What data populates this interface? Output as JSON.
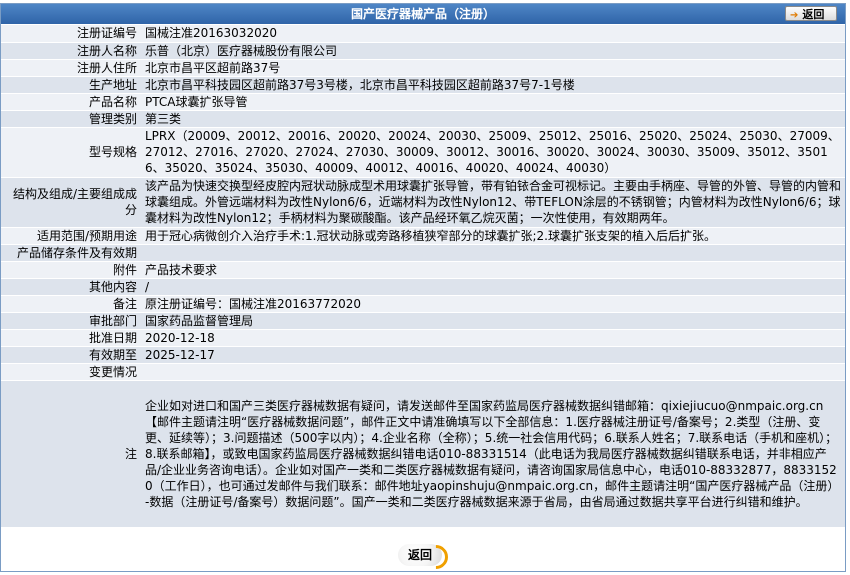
{
  "header": {
    "title": "国产医疗器械产品（注册）",
    "back_label": "返回"
  },
  "rows": [
    {
      "label": "注册证编号",
      "value": "国械注准20163032020"
    },
    {
      "label": "注册人名称",
      "value": "乐普（北京）医疗器械股份有限公司"
    },
    {
      "label": "注册人住所",
      "value": "北京市昌平区超前路37号"
    },
    {
      "label": "生产地址",
      "value": "北京市昌平科技园区超前路37号3号楼，北京市昌平科技园区超前路37号7-1号楼"
    },
    {
      "label": "产品名称",
      "value": "PTCA球囊扩张导管"
    },
    {
      "label": "管理类别",
      "value": "第三类"
    },
    {
      "label": "型号规格",
      "value": "LPRX（20009、20012、20016、20020、20024、20030、25009、25012、25016、25020、25024、25030、27009、27012、27016、27020、27024、27030、30009、30012、30016、30020、30024、30030、35009、35012、35016、35020、35024、35030、40009、40012、40016、40020、40024、40030）"
    },
    {
      "label": "结构及组成/主要组成成分",
      "value": "该产品为快速交换型经皮腔内冠状动脉成型术用球囊扩张导管，带有铂铱合金可视标记。主要由手柄座、导管的外管、导管的内管和球囊组成。外管远端材料为改性Nylon6/6，近端材料为改性Nylon12、带TEFLON涂层的不锈钢管；内管材料为改性Nylon6/6；球囊材料为改性Nylon12；手柄材料为聚碳酸酯。该产品经环氧乙烷灭菌；一次性使用，有效期两年。"
    },
    {
      "label": "适用范围/预期用途",
      "value": "用于冠心病微创介入治疗手术:1.冠状动脉或旁路移植狭窄部分的球囊扩张;2.球囊扩张支架的植入后后扩张。"
    },
    {
      "label": "产品储存条件及有效期",
      "value": ""
    },
    {
      "label": "附件",
      "value": "产品技术要求"
    },
    {
      "label": "其他内容",
      "value": "/"
    },
    {
      "label": "备注",
      "value": "原注册证编号：国械注准20163772020"
    },
    {
      "label": "审批部门",
      "value": "国家药品监督管理局"
    },
    {
      "label": "批准日期",
      "value": "2020-12-18"
    },
    {
      "label": "有效期至",
      "value": "2025-12-17"
    },
    {
      "label": "变更情况",
      "value": ""
    },
    {
      "label": "注",
      "value": "企业如对进口和国产三类医疗器械数据有疑问，请发送邮件至国家药监局医疗器械数据纠错邮箱：qixiejiucuo@nmpaic.org.cn【邮件主题请注明“医疗器械数据问题”，邮件正文中请准确填写以下全部信息：1.医疗器械注册证号/备案号；2.类型（注册、变更、延续等）；3.问题描述（500字以内）；4.企业名称（全称）；5.统一社会信用代码；6.联系人姓名；7.联系电话（手机和座机）；8.联系邮箱】，或致电国家药监局医疗器械数据纠错电话010-88331514（此电话为我局医疗器械数据纠错联系电话，并非相应产品/企业业务咨询电话）。企业如对国产一类和二类医疗器械数据有疑问，请咨询国家局信息中心，电话010-88332877，88331520（工作日），也可通过发邮件与我们联系：邮件地址yaopinshuju@nmpaic.org.cn，邮件主题请注明“国产医疗器械产品（注册）-数据（注册证号/备案号）数据问题”。国产一类和二类医疗器械数据来源于省局，由省局通过数据共享平台进行纠错和维护。"
    }
  ],
  "footer": {
    "back_label": "返回"
  }
}
